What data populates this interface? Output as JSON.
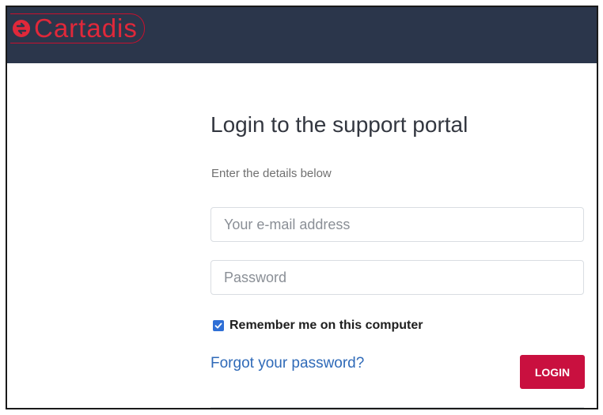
{
  "brand": {
    "name": "Cartadis",
    "color": "#e0283a",
    "header_color": "#2b364b"
  },
  "login": {
    "title": "Login to the support portal",
    "subtitle": "Enter the details below",
    "email_placeholder": "Your e-mail address",
    "password_placeholder": "Password",
    "remember_label": "Remember me on this computer",
    "remember_checked": true,
    "forgot_label": "Forgot your password?",
    "login_label": "LOGIN",
    "login_color": "#c9103f",
    "link_color": "#2f6ab8"
  },
  "icons": {
    "logo": "cartadis-logo-icon",
    "checkbox": "checkmark-icon"
  }
}
